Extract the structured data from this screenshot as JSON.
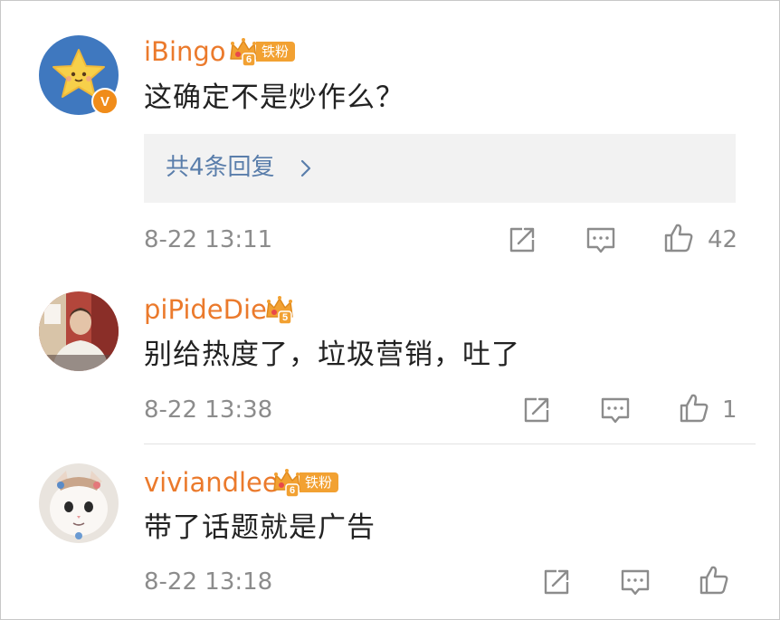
{
  "comments": [
    {
      "username": "iBingo",
      "fan_level": "6",
      "fan_tag": "铁粉",
      "verified_mark": "V",
      "text": "这确定不是炒作么？",
      "replies_label": "共4条回复",
      "time": "8-22 13:11",
      "likes": "42"
    },
    {
      "username": "piPideDie",
      "fan_level": "5",
      "text": "别给热度了，垃圾营销，吐了",
      "time": "8-22 13:38",
      "likes": "1"
    },
    {
      "username": "viviandlee",
      "fan_level": "6",
      "fan_tag": "铁粉",
      "text": "带了话题就是广告",
      "time": "8-22 13:18",
      "likes": ""
    }
  ],
  "icons": {
    "share": "share-icon",
    "comment": "comment-icon",
    "like": "thumbs-up-icon",
    "crown": "crown-badge-icon"
  },
  "colors": {
    "username": "#eb7a2c",
    "reply_link": "#5a7eab",
    "fan_tag": "#f2a132",
    "meta": "#8c8c8c"
  }
}
